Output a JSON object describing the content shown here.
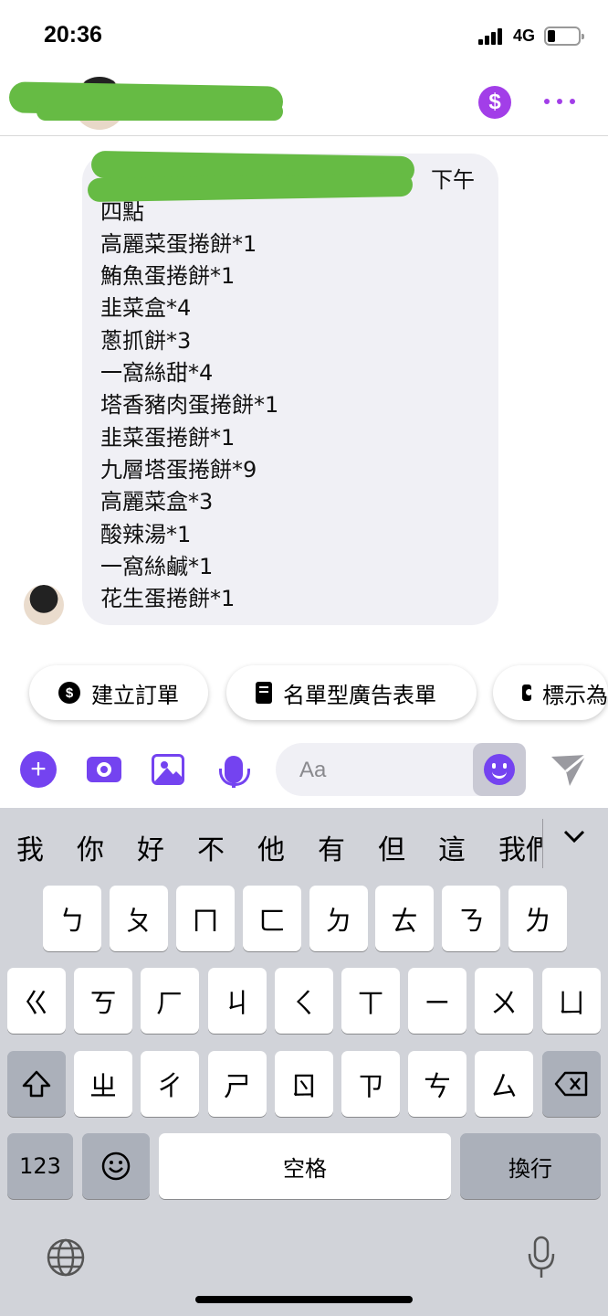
{
  "status_bar": {
    "time": "20:36",
    "network": "4G"
  },
  "header": {},
  "message": {
    "lines": [
      "下午",
      "四點",
      "高麗菜蛋捲餅*1",
      "鮪魚蛋捲餅*1",
      "韭菜盒*4",
      "蔥抓餅*3",
      "一窩絲甜*4",
      "塔香豬肉蛋捲餅*1",
      "韭菜蛋捲餅*1",
      "九層塔蛋捲餅*9",
      "高麗菜盒*3",
      "酸辣湯*1",
      "一窩絲鹹*1",
      "花生蛋捲餅*1"
    ]
  },
  "quick_replies": [
    {
      "label": "建立訂單",
      "icon": "dollar-icon"
    },
    {
      "label": "名單型廣告表單",
      "icon": "document-icon"
    },
    {
      "label": "標示為",
      "icon": "id-card-icon"
    }
  ],
  "composer": {
    "placeholder": "Aa"
  },
  "keyboard": {
    "candidates": [
      "我",
      "你",
      "好",
      "不",
      "他",
      "有",
      "但",
      "這",
      "我們"
    ],
    "row1": [
      "ㄅ",
      "ㄆ",
      "ㄇ",
      "ㄈ",
      "ㄉ",
      "ㄊ",
      "ㄋ",
      "ㄌ"
    ],
    "row2": [
      "ㄍ",
      "ㄎ",
      "ㄏ",
      "ㄐ",
      "ㄑ",
      "ㄒ",
      "ㄧ",
      "ㄨ",
      "ㄩ"
    ],
    "row3": [
      "ㄓ",
      "ㄔ",
      "ㄕ",
      "ㄖ",
      "ㄗ",
      "ㄘ",
      "ㄙ"
    ],
    "numbers_key": "123",
    "space_key": "空格",
    "return_key": "換行"
  },
  "colors": {
    "accent": "#7443f0",
    "payment": "#a23ee8",
    "bubble": "#f0f0f5",
    "keyboard_bg": "#d1d3d9"
  }
}
